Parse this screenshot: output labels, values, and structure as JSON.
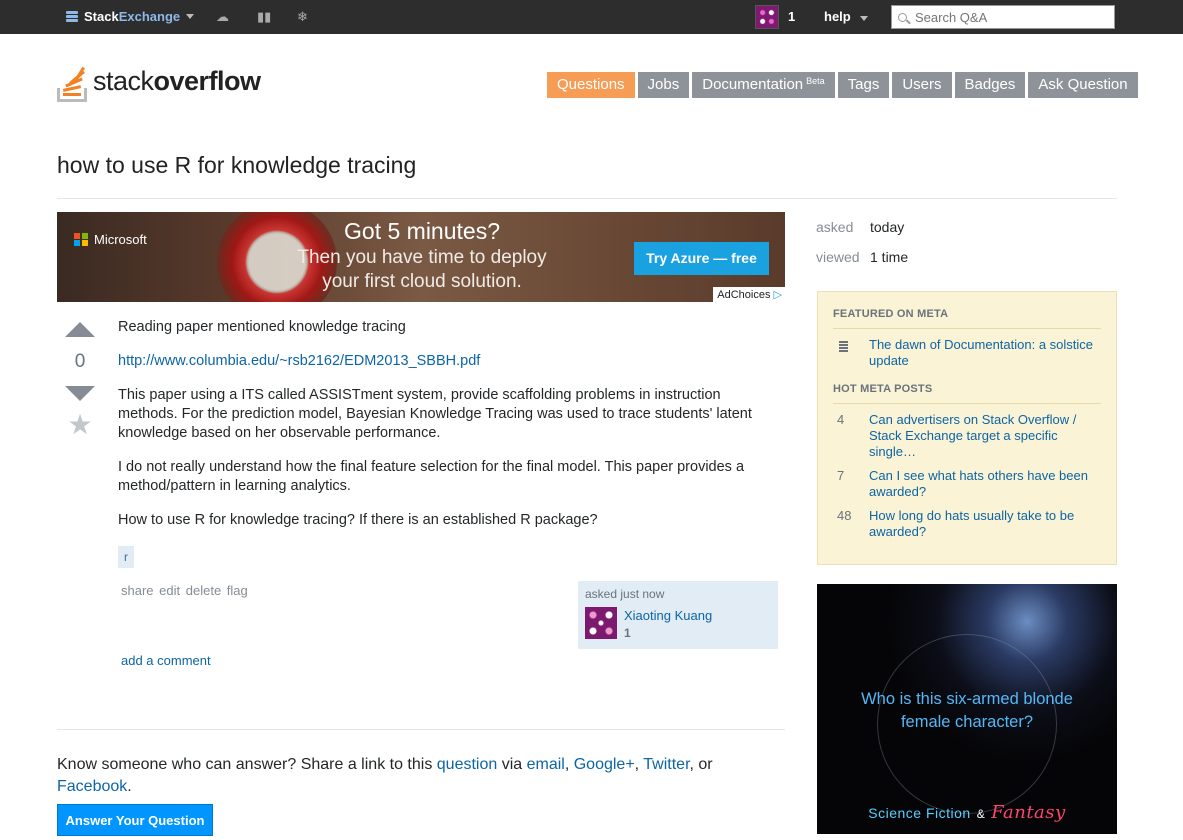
{
  "topbar": {
    "brand_a": "Stack",
    "brand_b": "Exchange",
    "reputation": "1",
    "help": "help",
    "search_placeholder": "Search Q&A",
    "icons": [
      "inbox-icon",
      "achievements-icon",
      "review-icon",
      "snowflake-icon"
    ]
  },
  "logo": {
    "text_a": "stack",
    "text_b": "overflow"
  },
  "nav": {
    "items": [
      "Questions",
      "Jobs",
      "Documentation",
      "Tags",
      "Users",
      "Badges",
      "Ask Question"
    ],
    "beta": "Beta",
    "active": "Questions",
    "active_color": "#f69c55",
    "inactive_color": "#8e9399"
  },
  "question": {
    "title": "how to use R for knowledge tracing",
    "votes": "0",
    "p1": "Reading paper mentioned knowledge tracing",
    "link": "http://www.columbia.edu/~rsb2162/EDM2013_SBBH.pdf",
    "p2": "This paper using a ITS called ASSISTment system, provide scaffolding problems in instruction methods. For the prediction model, Bayesian Knowledge Tracing was used to trace students' latent knowledge based on her observable performance.",
    "p3": "I do not really understand how the final feature selection for the final model. This paper provides a method/pattern in learning analytics.",
    "p4": "How to use R for knowledge tracing? If there is an established R package?",
    "tag": "r",
    "actions": {
      "share": "share",
      "edit": "edit",
      "delete": "delete",
      "flag": "flag"
    },
    "asked_time": "asked just now",
    "author": "Xiaoting Kuang",
    "author_rep": "1",
    "add_comment": "add a comment"
  },
  "ad": {
    "brand": "Microsoft",
    "headline": "Got 5 minutes?",
    "line1": "Then you have time to deploy",
    "line2": "your first cloud solution.",
    "button": "Try Azure — free",
    "adchoices": "AdChoices"
  },
  "share": {
    "pre": "Know someone who can answer? Share a link to this ",
    "question": "question",
    "via": " via ",
    "email": "email",
    "comma1": ", ",
    "gplus": "Google+",
    "comma2": ", ",
    "twitter": "Twitter",
    "or": ", or",
    "facebook": "Facebook",
    "dot": ".",
    "answer_button": "Answer Your Question"
  },
  "meta": {
    "asked_label": "asked",
    "asked_value": "today",
    "viewed_label": "viewed",
    "viewed_value": "1 time"
  },
  "sidebar": {
    "featured_title": "FEATURED ON META",
    "featured": "The dawn of Documentation: a solstice update",
    "hot_title": "HOT META POSTS",
    "hot": [
      {
        "count": "4",
        "title": "Can advertisers on Stack Overflow / Stack Exchange target a specific single…"
      },
      {
        "count": "7",
        "title": "Can I see what hats others have been awarded?"
      },
      {
        "count": "48",
        "title": "How long do hats usually take to be awarded?"
      }
    ]
  },
  "sf_ad": {
    "question": "Who is this six-armed blonde female character?",
    "brand_a": "Science Fiction",
    "amp": "&",
    "brand_b": "Fantasy"
  }
}
